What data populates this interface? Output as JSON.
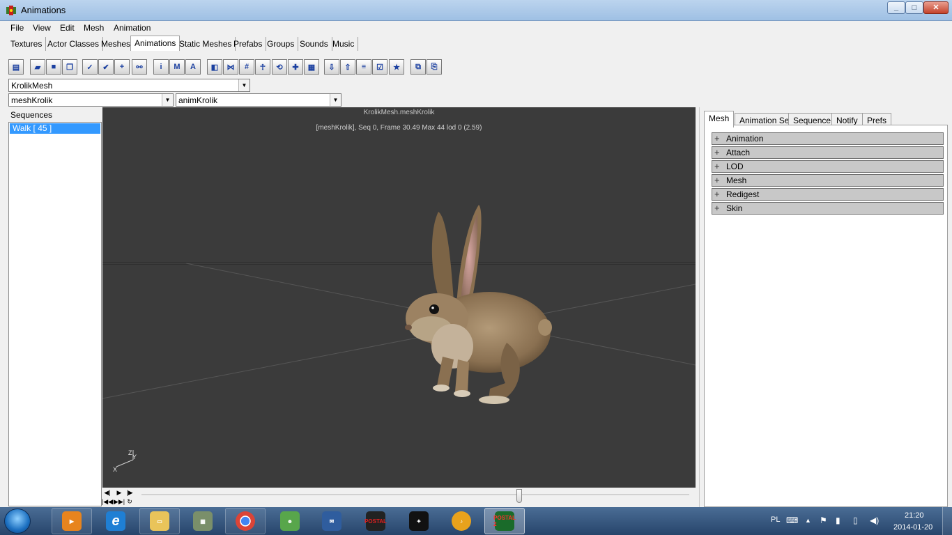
{
  "window": {
    "title": "Animations",
    "controls": {
      "minimize": "_",
      "maximize": "□",
      "close": "✕"
    }
  },
  "menu": [
    "File",
    "View",
    "Edit",
    "Mesh",
    "Animation"
  ],
  "browser_tabs": {
    "items": [
      "Textures",
      "Actor Classes",
      "Meshes",
      "Animations",
      "Static Meshes",
      "Prefabs",
      "Groups",
      "Sounds",
      "Music"
    ],
    "active": "Animations"
  },
  "toolbar_icons": [
    "browser-icon",
    "open-icon",
    "save-icon",
    "copy-icon",
    "check-icon",
    "check-edit-icon",
    "add-icon",
    "link-icon",
    "info-icon",
    "mesh-props-icon",
    "anim-props-icon",
    "cube-icon",
    "skeleton-icon",
    "grid-icon",
    "bone-icon",
    "reset-icon",
    "cross-icon",
    "wireframe-icon",
    "import-icon",
    "export-icon",
    "lod-icon",
    "verify-icon",
    "notify-icon",
    "duplicate-icon",
    "paste-icon"
  ],
  "selectors": {
    "mesh_group": "KrolikMesh",
    "mesh": "meshKrolik",
    "animation": "animKrolik"
  },
  "sequences": {
    "label": "Sequences",
    "items": [
      "Walk [ 45 ]"
    ]
  },
  "viewport": {
    "title": "KrolikMesh.meshKrolik",
    "status": "[meshKrolik], Seq 0,  Frame 30.49 Max 44  lod 0 (2.59)",
    "axis_labels": {
      "z": "Z",
      "y": "Y",
      "x": "X"
    },
    "background": "#3b3b3b"
  },
  "timeline": {
    "buttons": [
      "◀|",
      "▶",
      "|▶",
      "|◀◀",
      "▶▶|",
      "↻"
    ],
    "position": 0.69
  },
  "properties": {
    "tabs": [
      "Mesh",
      "Animation Set",
      "Sequence",
      "Notify",
      "Prefs"
    ],
    "active_tab": "Mesh",
    "categories": [
      "Animation",
      "Attach",
      "LOD",
      "Mesh",
      "Redigest",
      "Skin"
    ],
    "expander": "+"
  },
  "taskbar": {
    "apps": [
      {
        "name": "media-player",
        "label": ""
      },
      {
        "name": "internet-explorer",
        "label": "e"
      },
      {
        "name": "file-explorer",
        "label": ""
      },
      {
        "name": "archive-app",
        "label": ""
      },
      {
        "name": "chrome",
        "label": ""
      },
      {
        "name": "messenger",
        "label": ""
      },
      {
        "name": "outlook",
        "label": ""
      },
      {
        "name": "postal",
        "label": "POSTAL"
      },
      {
        "name": "hitman",
        "label": ""
      },
      {
        "name": "fl-studio",
        "label": ""
      },
      {
        "name": "postal-2",
        "label": "POSTAL 2"
      }
    ],
    "tray": {
      "language": "PL",
      "time": "21:20",
      "date": "2014-01-20"
    }
  }
}
